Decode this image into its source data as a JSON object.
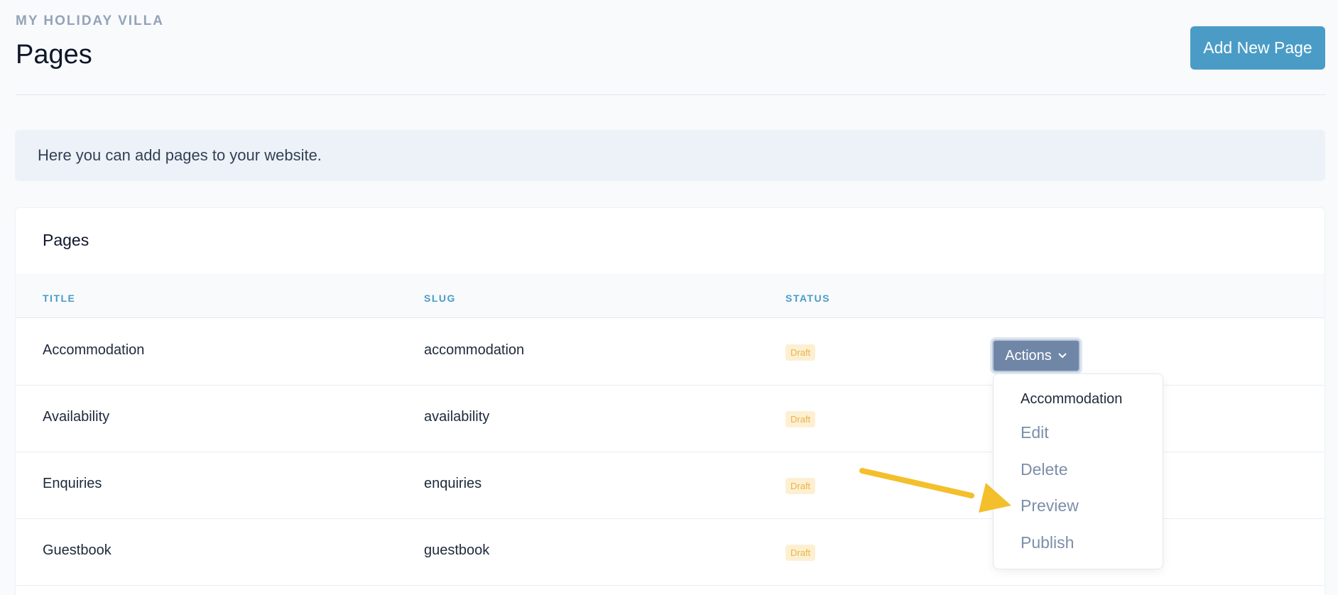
{
  "header": {
    "site_name": "MY HOLIDAY VILLA",
    "title": "Pages",
    "add_button": "Add New Page"
  },
  "info": {
    "text": "Here you can add pages to your website."
  },
  "card": {
    "title": "Pages",
    "columns": {
      "title": "TITLE",
      "slug": "SLUG",
      "status": "STATUS"
    },
    "rows": [
      {
        "title": "Accommodation",
        "slug": "accommodation",
        "status": "Draft"
      },
      {
        "title": "Availability",
        "slug": "availability",
        "status": "Draft"
      },
      {
        "title": "Enquiries",
        "slug": "enquiries",
        "status": "Draft"
      },
      {
        "title": "Guestbook",
        "slug": "guestbook",
        "status": "Draft"
      }
    ]
  },
  "actions": {
    "label": "Actions",
    "icon": "chevron-down-icon",
    "dropdown_header": "Accommodation",
    "items": [
      "Edit",
      "Delete",
      "Preview",
      "Publish"
    ]
  },
  "annotation": {
    "icon": "arrow-icon",
    "color": "#f3bf2b"
  },
  "colors": {
    "accent": "#4a9cc6",
    "actions_button": "#6f86a7",
    "draft_badge_bg": "#fdf0d2",
    "draft_badge_text": "#eab34a"
  }
}
